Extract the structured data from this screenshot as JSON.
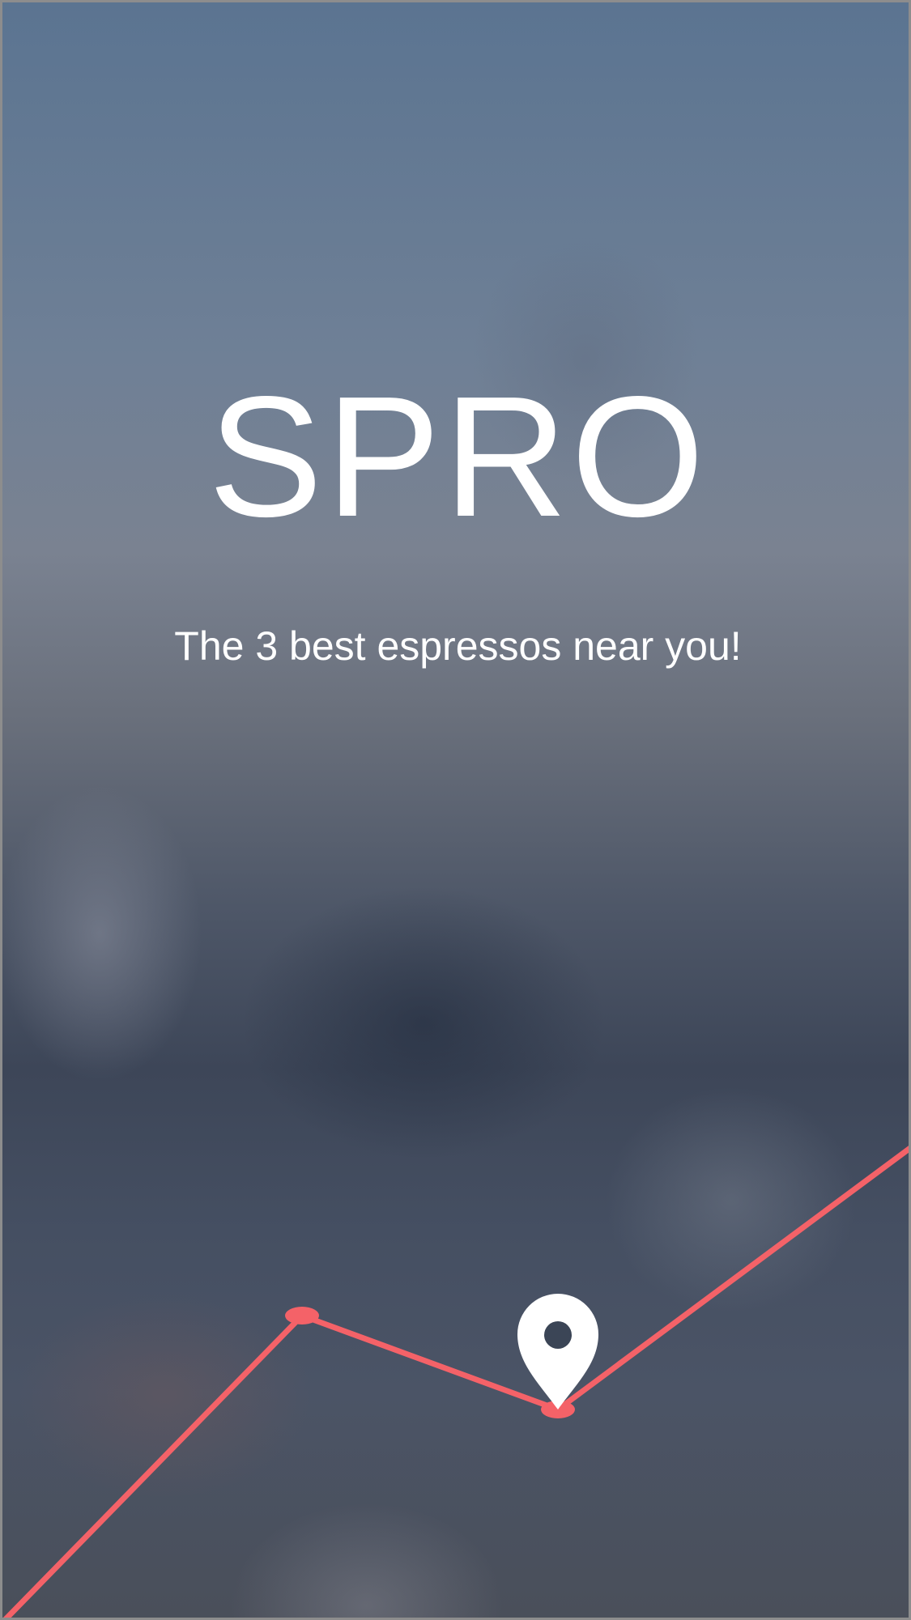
{
  "app": {
    "title": "SPRO",
    "tagline": "The 3 best espressos near you!"
  },
  "icons": {
    "marker": "map-pin-icon"
  },
  "colors": {
    "route": "#f46268",
    "text": "#ffffff",
    "pin": "#ffffff",
    "pin_hole": "#3b4556"
  }
}
